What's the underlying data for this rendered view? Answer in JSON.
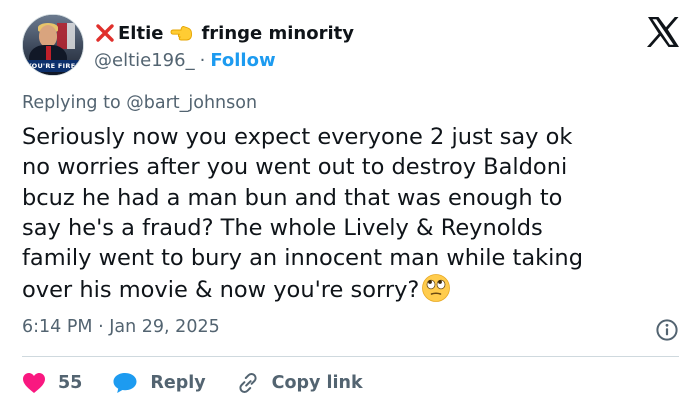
{
  "user": {
    "display_name": "Eltie",
    "badge_text": "fringe minority",
    "handle": "@eltie196_",
    "separator": "·",
    "follow_label": "Follow",
    "avatar_caption": "YOU'RE FIRED"
  },
  "reply": {
    "prefix": "Replying to ",
    "to_handle": "@bart_johnson"
  },
  "tweet": {
    "lines": [
      "Seriously now you expect everyone 2 just say ok",
      "no worries after you went out to destroy Baldoni",
      "bcuz he had a man bun and that was enough to",
      "say he's a fraud? The whole Lively & Reynolds",
      "family went to bury an innocent man while taking",
      "over his movie & now you're sorry?"
    ],
    "trailing_emoji": "face-with-rolling-eyes"
  },
  "meta": {
    "time": "6:14 PM",
    "separator": "·",
    "date": "Jan 29, 2025"
  },
  "actions": {
    "like_count": "55",
    "reply_label": "Reply",
    "copy_label": "Copy link"
  },
  "icons": {
    "x_mark": "cross-mark-icon",
    "pointing": "backhand-index-pointing-left-icon",
    "logo": "x-logo-icon",
    "info": "info-icon",
    "heart": "heart-icon",
    "reply": "speech-bubble-icon",
    "link": "link-icon"
  },
  "colors": {
    "text": "#0f1419",
    "muted": "#536471",
    "accent": "#1d9bf0",
    "heart": "#f91880",
    "reply_bubble": "#1d9bf0",
    "cross": "#e0302c",
    "divider": "#cfd9de"
  }
}
